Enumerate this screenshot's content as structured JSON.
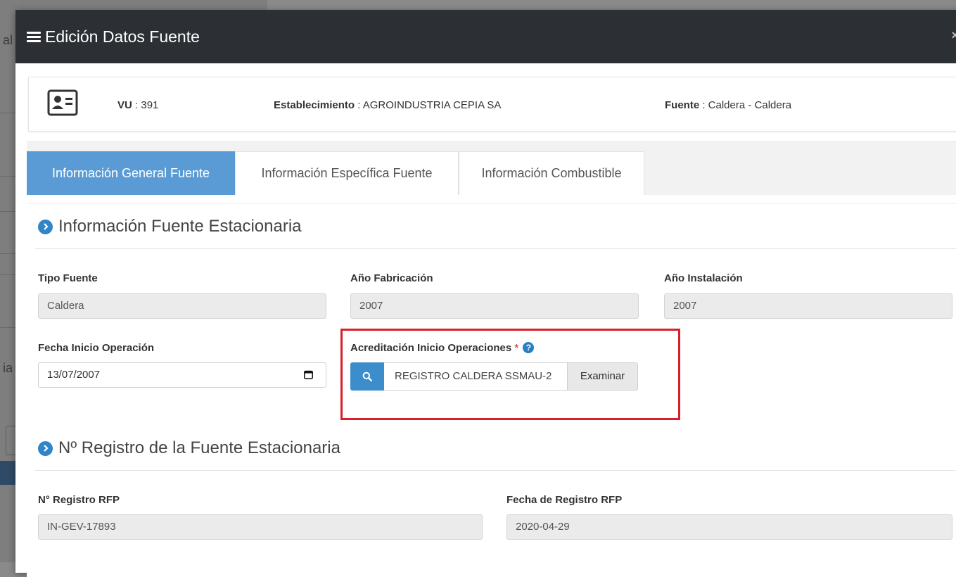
{
  "background_fragments": [
    "al",
    "ia"
  ],
  "modal": {
    "title": "Edición Datos Fuente",
    "close_glyph": "×"
  },
  "info": {
    "icon": "id-card-icon",
    "vu_label": "VU",
    "vu_value": ": 391",
    "establecimiento_label": "Establecimiento",
    "establecimiento_value": ": AGROINDUSTRIA CEPIA SA",
    "fuente_label": "Fuente",
    "fuente_value": ": Caldera - Caldera"
  },
  "tabs": [
    {
      "label": "Información General Fuente",
      "active": true
    },
    {
      "label": "Información Específica Fuente",
      "active": false
    },
    {
      "label": "Información Combustible",
      "active": false
    }
  ],
  "section1": {
    "title": "Información Fuente Estacionaria",
    "tipo_fuente": {
      "label": "Tipo Fuente",
      "value": "Caldera"
    },
    "anio_fabricacion": {
      "label": "Año Fabricación",
      "value": "2007"
    },
    "anio_instalacion": {
      "label": "Año Instalación",
      "value": "2007"
    },
    "fecha_inicio": {
      "label": "Fecha Inicio Operación",
      "value": "13/07/2007"
    },
    "acreditacion": {
      "label": "Acreditación Inicio Operaciones",
      "required_mark": "*",
      "help_glyph": "?",
      "file_name": "REGISTRO CALDERA SSMAU-2",
      "browse_label": "Examinar"
    }
  },
  "section2": {
    "title": "Nº Registro de la Fuente Estacionaria",
    "registro_rfp": {
      "label": "N° Registro RFP",
      "value": "IN-GEV-17893"
    },
    "fecha_registro": {
      "label": "Fecha de Registro RFP",
      "value": "2020-04-29"
    }
  },
  "colors": {
    "header_bg": "#2c3035",
    "tab_active": "#5b9bd5",
    "primary_blue": "#3c8dcc",
    "highlight_red": "#d71f2b"
  }
}
